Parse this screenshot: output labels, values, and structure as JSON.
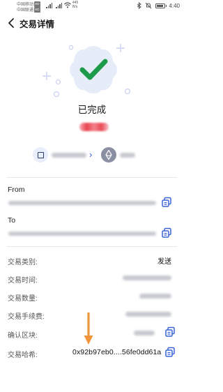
{
  "status_bar": {
    "carrier_1": "中国移动",
    "carrier_2": "中国联通",
    "net_badge": "HD",
    "net_speed_value": "445",
    "net_speed_unit": "B/s",
    "time": "4:40"
  },
  "header": {
    "title": "交易详情"
  },
  "hero": {
    "status_text": "已完成"
  },
  "addresses": {
    "from_label": "From",
    "to_label": "To"
  },
  "details": {
    "type_label": "交易类别:",
    "type_value": "发送",
    "time_label": "交易时间:",
    "amount_label": "交易数量:",
    "fee_label": "交易手续费:",
    "block_label": "确认区块:",
    "hash_label": "交易哈希:",
    "hash_value": "0x92b97eb0....56fe0dd61a"
  },
  "colors": {
    "accent": "#3a63d8",
    "success": "#1e9b4a",
    "annotation_arrow": "#f0953c",
    "amount_red": "#e8434f"
  }
}
